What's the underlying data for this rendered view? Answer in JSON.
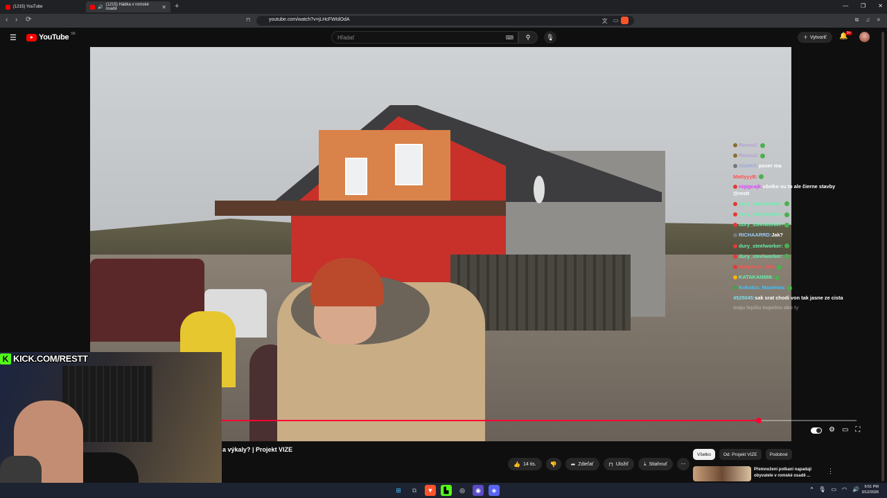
{
  "browser": {
    "tabs": [
      {
        "label": "(1215) YouTube",
        "active": false
      },
      {
        "label": "(1215) Hádka v romské osadě",
        "active": true
      }
    ],
    "url": "youtube.com/watch?v=jLHcFWIdOdA"
  },
  "header": {
    "logo": "YouTube",
    "country": "SK",
    "search_placeholder": "Hľadať",
    "create_label": "Vytvoriť",
    "notifications_count": "9+"
  },
  "video": {
    "progress": 0.846,
    "title": "a výkaly? | Projekt VIZE"
  },
  "chat": [
    {
      "user": "Rossu1:",
      "message": "",
      "color": "#b39ddb",
      "badge": "#8b6d2a"
    },
    {
      "user": "Rossu1:",
      "message": "",
      "color": "#b39ddb",
      "badge": "#8b6d2a"
    },
    {
      "user": "AlaeKK:",
      "message": "poser ma",
      "color": "#9fa8da",
      "badge": "#777777"
    },
    {
      "user": "MattyyyB:",
      "message": "",
      "color": "#ff5252",
      "badge": ""
    },
    {
      "user": "nigigcajk:",
      "message": "všetko su to ale čierne stavby @restt",
      "color": "#e040fb",
      "badge": "#e53935"
    },
    {
      "user": "dury_steelworker:",
      "message": "",
      "color": "#69f0ae",
      "badge": "#e53935"
    },
    {
      "user": "dury_steelworker:",
      "message": "",
      "color": "#69f0ae",
      "badge": "#e53935"
    },
    {
      "user": "dury_steelworker:",
      "message": "",
      "color": "#69f0ae",
      "badge": "#e53935"
    },
    {
      "user": "RICHAARRD:",
      "message": "Jak?",
      "color": "#9ecbff",
      "badge": "#777777"
    },
    {
      "user": "dury_steelworker:",
      "message": "",
      "color": "#69f0ae",
      "badge": "#e53935"
    },
    {
      "user": "dury_steelworker:",
      "message": "",
      "color": "#69f0ae",
      "badge": "#e53935"
    },
    {
      "user": "Marpilaus_OG:",
      "message": "",
      "color": "#ff5252",
      "badge": "#e53935"
    },
    {
      "user": "KATAKAN666:",
      "message": "",
      "color": "#69f0ae",
      "badge": "#ffb300"
    },
    {
      "user": "Kokotus_Maximus:",
      "message": "",
      "color": "#40c4ff",
      "badge": "#43a047"
    },
    {
      "user": "4525045:",
      "message": "sak srat chodi von tak jasne ze cista",
      "color": "#80deea",
      "badge": ""
    },
    {
      "user": "",
      "message": "",
      "color": "#9fa8da",
      "badge": ""
    },
    {
      "user": "",
      "message": "maju lepšiu kupelnu ako ty",
      "color": "#9fa8da",
      "badge": ""
    }
  ],
  "overlay": {
    "kick_text": "KICK.COM/RESTT"
  },
  "actions": {
    "likes": "14 tis.",
    "share": "Zdieľať",
    "save": "Uložiť",
    "download": "Stiahnuť"
  },
  "chips": [
    "Všetko",
    "Od: Projekt VIZE",
    "Podobné"
  ],
  "recommendation": {
    "title": "Přemnožení potkani napadají obyvatele v romské osadě ..."
  },
  "taskbar": {
    "time": "9:51 PM",
    "date": "3/12/2026"
  }
}
